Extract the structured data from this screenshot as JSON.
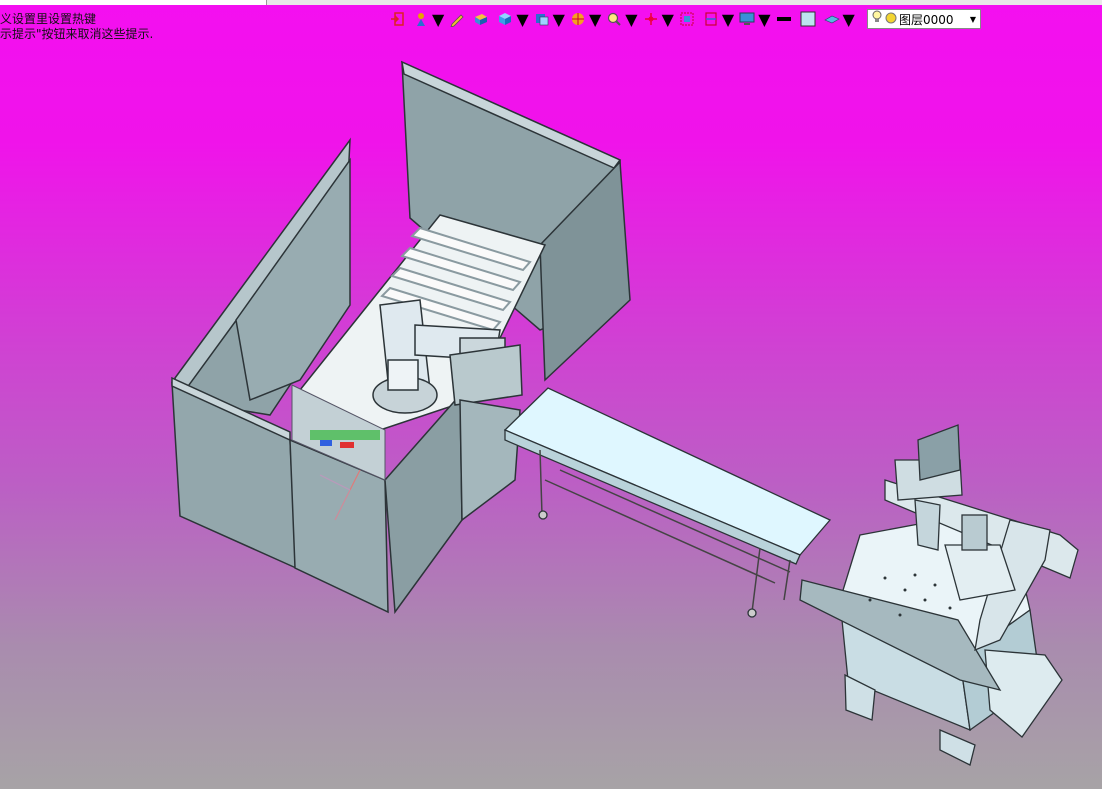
{
  "window": {
    "title_fragment": ""
  },
  "hints": {
    "line1": "义设置里设置热键",
    "line2": "示提示\"按钮来取消这些提示."
  },
  "toolbar": {
    "icons": [
      "exit-icon",
      "pick-filter-icon",
      "pen-icon",
      "solid-box-icon",
      "view-cube-icon",
      "display-mode-icon",
      "color-wheel-icon",
      "zoom-icon",
      "origin-icon",
      "fit-view-icon",
      "section-icon",
      "monitor-icon",
      "line-style-icon",
      "fill-color-icon",
      "material-icon"
    ]
  },
  "layer": {
    "name": "图层0000"
  },
  "colors": {
    "bg_top": "#f40ff0",
    "bg_bottom": "#a7a3a6",
    "panel": "#8fa3a8",
    "panel_light": "#b9c9cd",
    "machine": "#dfe9ef",
    "frame": "#2c3438"
  }
}
